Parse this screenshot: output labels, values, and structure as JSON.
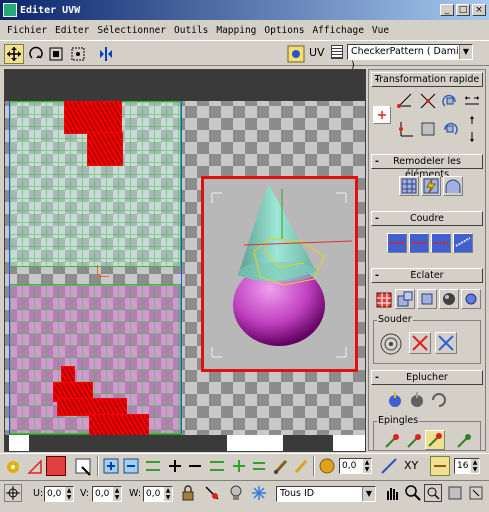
{
  "window": {
    "title": "Editer UVW",
    "controls": {
      "minimize": "_",
      "maximize": "□",
      "close": "×"
    }
  },
  "menu": [
    "Fichier",
    "Editer",
    "Sélectionner",
    "Outils",
    "Mapping",
    "Options",
    "Affichage",
    "Vue"
  ],
  "toolbar": {
    "uv_label": "UV",
    "texture_select": "CheckerPattern  ( Damier )"
  },
  "panel": {
    "rollouts": {
      "transformation": "Transformation rapide",
      "remodeler": "Remodeler les éléments",
      "coudre": "Coudre",
      "eclater": "Eclater",
      "souder": "Souder",
      "eplucher": "Eplucher",
      "epingles": "Epingles"
    }
  },
  "bottom": {
    "spinner_top": "0,0",
    "axis_label": "XY",
    "spinner_right": "16",
    "u_label": "U:",
    "u_value": "0,0",
    "v_label": "V:",
    "v_value": "0,0",
    "w_label": "W:",
    "w_value": "0,0",
    "id_select": "Tous ID"
  },
  "colors": {
    "titlebar_start": "#0a246a",
    "titlebar_end": "#a6caf0",
    "selection": "#ff0000",
    "uv_grid": "#30c030",
    "cone": "#80d8c0",
    "sphere": "#c040c0"
  }
}
